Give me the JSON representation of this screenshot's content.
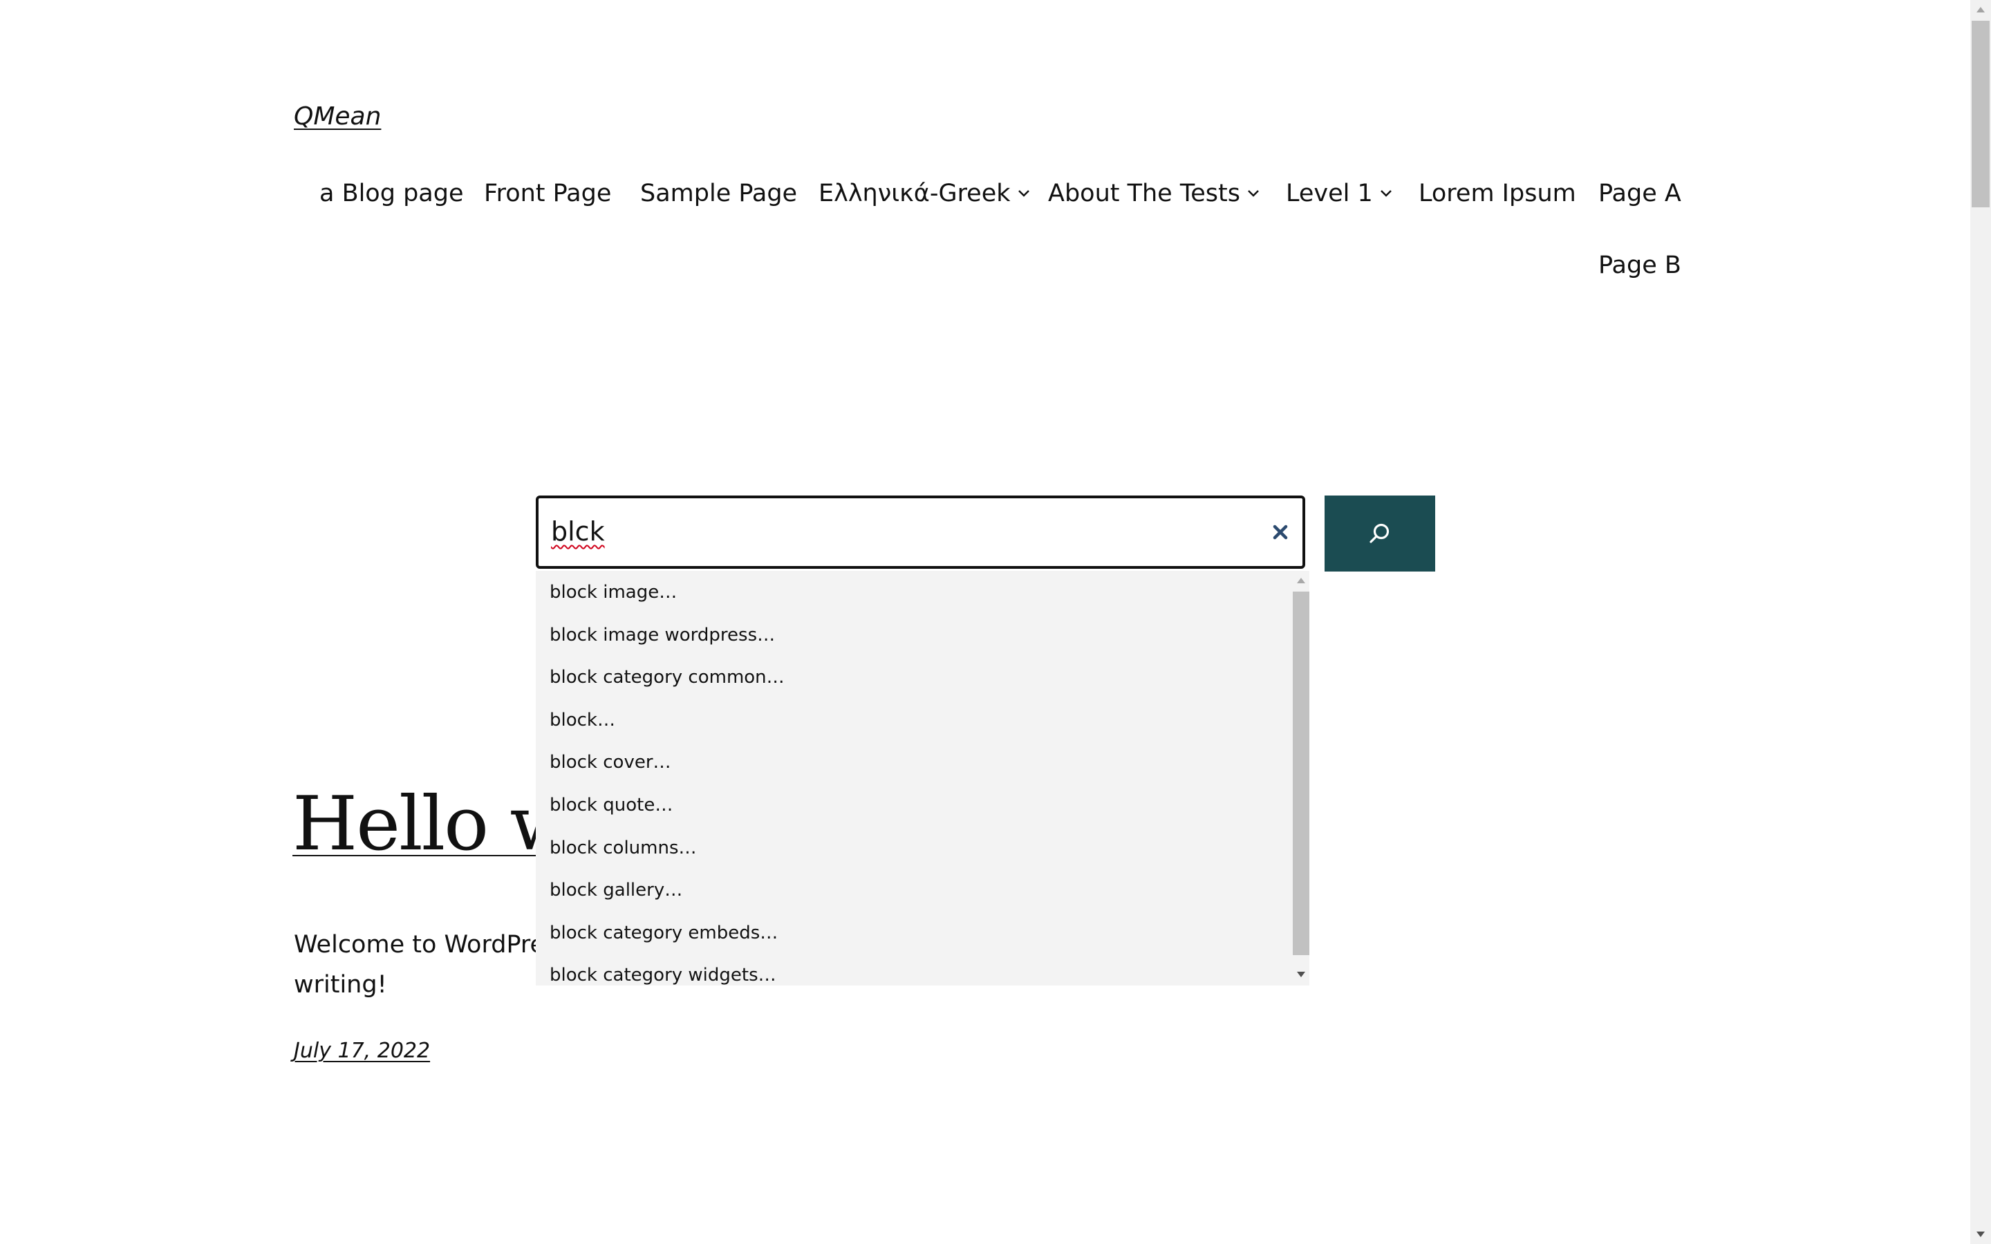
{
  "site": {
    "title": "QMean"
  },
  "nav": {
    "items": [
      {
        "label": "a Blog page",
        "has_submenu": false
      },
      {
        "label": "Front Page",
        "has_submenu": false
      },
      {
        "label": "Sample Page",
        "has_submenu": false
      },
      {
        "label": "Ελληνικά-Greek",
        "has_submenu": true
      },
      {
        "label": "About The Tests",
        "has_submenu": true
      },
      {
        "label": "Level 1",
        "has_submenu": true
      },
      {
        "label": "Lorem Ipsum",
        "has_submenu": false
      },
      {
        "label": "Page A",
        "has_submenu": false
      },
      {
        "label": "Page B",
        "has_submenu": false
      }
    ]
  },
  "search": {
    "value": "blck",
    "clear_icon": "close-icon",
    "button_icon": "search-icon",
    "button_color": "#1b4c52",
    "suggestions": [
      "block image…",
      "block image wordpress…",
      "block category common…",
      "block…",
      "block cover…",
      "block quote…",
      "block columns…",
      "block gallery…",
      "block category embeds…",
      "block category widgets…"
    ]
  },
  "post": {
    "title": "Hello wo",
    "excerpt": "Welcome to WordPre",
    "excerpt_line2": "writing!",
    "date": "July 17, 2022"
  }
}
